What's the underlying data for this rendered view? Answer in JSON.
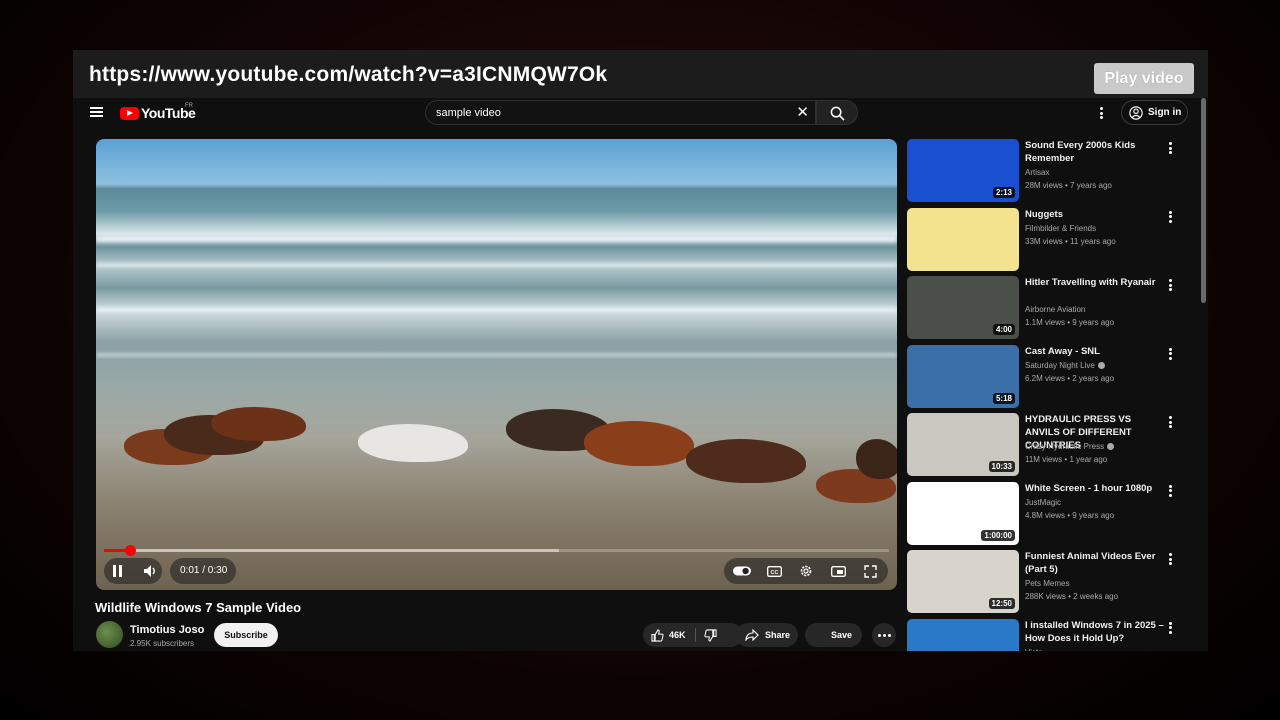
{
  "browser": {
    "url": "https://www.youtube.com/watch?v=a3ICNMQW7Ok",
    "play_video_label": "Play video"
  },
  "header": {
    "logo_text": "YouTube",
    "region": "FR",
    "search_value": "sample video",
    "signin_label": "Sign in"
  },
  "player": {
    "time_display": "0:01 / 0:30",
    "progress_played_fraction": 0.033,
    "progress_buffered_fraction": 0.58
  },
  "video": {
    "title": "Wildlife Windows 7 Sample Video",
    "channel": "Timotius Joso",
    "subscribers": "2.95K subscribers",
    "subscribe_label": "Subscribe",
    "likes": "46K",
    "share_label": "Share",
    "save_label": "Save"
  },
  "recommendations": [
    {
      "title": "Sound Every 2000s Kids Remember",
      "channel": "Artisax",
      "meta": "28M views • 7 years ago",
      "duration": "2:13",
      "verified": false,
      "thumb_color": "#1a4fd0"
    },
    {
      "title": "Nuggets",
      "channel": "Filmbilder & Friends",
      "meta": "33M views • 11 years ago",
      "duration": "",
      "verified": false,
      "thumb_color": "#f3e38f"
    },
    {
      "title": "Hitler Travelling with Ryanair",
      "channel": "Airborne Aviation",
      "meta": "1.1M views • 9 years ago",
      "duration": "4:00",
      "verified": false,
      "thumb_color": "#4a4f4a"
    },
    {
      "title": "Cast Away - SNL",
      "channel": "Saturday Night Live",
      "meta": "6.2M views • 2 years ago",
      "duration": "5:18",
      "verified": true,
      "thumb_color": "#3a6fa8"
    },
    {
      "title": "HYDRAULIC PRESS VS ANVILS OF DIFFERENT COUNTRIES",
      "channel": "Crazy Hydraulic Press",
      "meta": "11M views • 1 year ago",
      "duration": "10:33",
      "verified": true,
      "thumb_color": "#c8c8c0"
    },
    {
      "title": "White Screen - 1 hour 1080p",
      "channel": "JustMagic",
      "meta": "4.8M views • 9 years ago",
      "duration": "1:00:00",
      "verified": false,
      "thumb_color": "#ffffff"
    },
    {
      "title": "Funniest Animal Videos Ever (Part 5)",
      "channel": "Pets Memes",
      "meta": "288K views • 2 weeks ago",
      "duration": "12:50",
      "verified": false,
      "thumb_color": "#d8d4cc"
    },
    {
      "title": "I installed Windows 7 in 2025 – How Does it Hold Up?",
      "channel": "Vista",
      "meta": "",
      "duration": "",
      "verified": false,
      "thumb_color": "#2a78c8"
    }
  ]
}
